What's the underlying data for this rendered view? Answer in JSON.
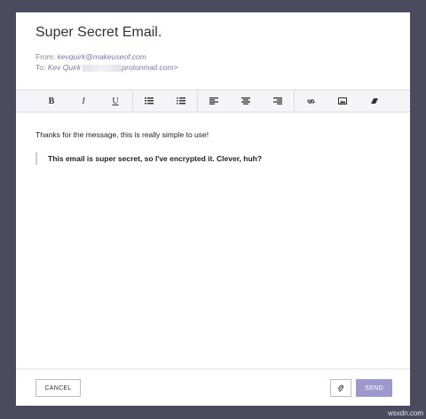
{
  "email": {
    "subject": "Super Secret Email.",
    "from_label": "From:",
    "from_value": "kevquirk@makeuseof.com",
    "to_label": "To:",
    "to_name": "Kev Quirk",
    "to_domain": "protonmail.com>"
  },
  "toolbar": {
    "bold": "B",
    "italic": "I",
    "underline": "U",
    "icons": [
      "bulleted-list-icon",
      "numbered-list-icon",
      "align-left-icon",
      "align-center-icon",
      "align-right-icon",
      "link-icon",
      "image-icon",
      "eraser-icon"
    ]
  },
  "body": {
    "line1": "Thanks for the message, this is really simple to use!",
    "quote": "This email is super secret, so I've encrypted it. Clever, huh?"
  },
  "footer": {
    "cancel_label": "CANCEL",
    "send_label": "SEND"
  },
  "watermark": "wsxdn.com",
  "colors": {
    "background": "#4c4a5f",
    "accent": "#9d99cc",
    "link": "#7a73b8"
  }
}
